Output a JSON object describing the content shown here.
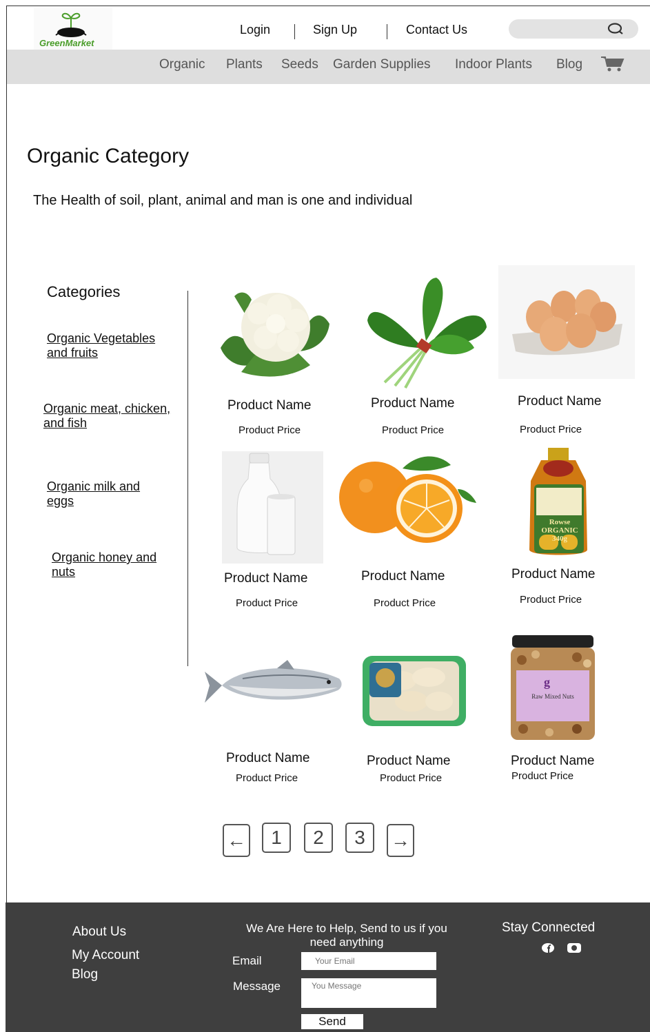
{
  "brand": {
    "name": "GreenMarket"
  },
  "top_links": [
    {
      "label": "Login"
    },
    {
      "label": "Sign Up"
    },
    {
      "label": "Contact Us"
    }
  ],
  "search": {
    "icon": "search-icon"
  },
  "nav": [
    {
      "label": "Organic"
    },
    {
      "label": "Plants"
    },
    {
      "label": "Seeds"
    },
    {
      "label": "Garden Supplies"
    },
    {
      "label": "Indoor Plants"
    },
    {
      "label": "Blog"
    }
  ],
  "page": {
    "title": "Organic Category",
    "subtitle": "The Health of soil, plant, animal and man is one and individual"
  },
  "categories": {
    "title": "Categories",
    "items": [
      {
        "line1": "Organic Vegetables",
        "line2": "and fruits"
      },
      {
        "line1": "Organic meat, chicken,",
        "line2": "and fish"
      },
      {
        "line1": "Organic milk and",
        "line2": "eggs"
      },
      {
        "line1": "Organic honey and",
        "line2": "nuts"
      }
    ]
  },
  "products": [
    {
      "name": "Product Name",
      "price": "Product Price",
      "image": "cauliflower"
    },
    {
      "name": "Product Name",
      "price": "Product Price",
      "image": "spinach"
    },
    {
      "name": "Product Name",
      "price": "Product Price",
      "image": "eggs"
    },
    {
      "name": "Product Name",
      "price": "Product Price",
      "image": "milk"
    },
    {
      "name": "Product Name",
      "price": "Product Price",
      "image": "orange"
    },
    {
      "name": "Product Name",
      "price": "Product Price",
      "image": "honey",
      "label_text": "Rowse ORGANIC 340g"
    },
    {
      "name": "Product Name",
      "price": "Product Price",
      "image": "salmon"
    },
    {
      "name": "Product Name",
      "price": "Product Price",
      "image": "chicken"
    },
    {
      "name": "Product Name",
      "price": "Product Price",
      "image": "mixed-nuts",
      "label_text": "Raw Mixed Nuts"
    }
  ],
  "pagination": {
    "prev": "←",
    "pages": [
      "1",
      "2",
      "3"
    ],
    "next": "→"
  },
  "footer": {
    "links": [
      "About Us",
      "My Account",
      "Blog"
    ],
    "help_line1": "We Are Here to Help, Send to us if you",
    "help_line2": "need anything",
    "email_label": "Email",
    "email_placeholder": "Your Email",
    "message_label": "Message",
    "message_placeholder": "You Message",
    "send_label": "Send",
    "stay_connected": "Stay Connected",
    "social_icons": [
      "facebook-icon",
      "instagram-icon"
    ]
  },
  "colors": {
    "brand_green": "#4a9d2a",
    "nav_bg": "#dedede",
    "footer_bg": "#3f3f3f"
  }
}
